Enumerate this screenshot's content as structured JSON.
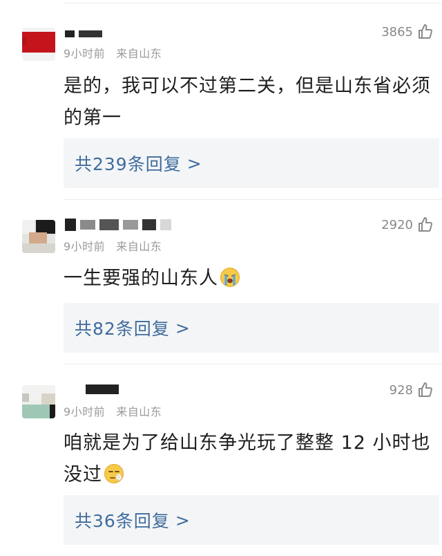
{
  "comments": [
    {
      "time": "9小时前",
      "location": "来自山东",
      "likes": "3865",
      "text": "是的，我可以不过第二关，但是山东省必须的第一",
      "reply_count": "共239条回复",
      "avatar_icon": "blurred-avatar",
      "like_icon": "thumbs-up-icon"
    },
    {
      "time": "9小时前",
      "location": "来自山东",
      "likes": "2920",
      "text": "一生要强的山东人",
      "emoji": "crying-face-emoji",
      "reply_count": "共82条回复",
      "avatar_icon": "blurred-avatar",
      "like_icon": "thumbs-up-icon"
    },
    {
      "time": "9小时前",
      "location": "来自山东",
      "likes": "928",
      "text": "咱就是为了给山东争光玩了整整 12 小时也没过",
      "emoji": "smirk-face-emoji",
      "reply_count": "共36条回复",
      "avatar_icon": "blurred-avatar",
      "like_icon": "thumbs-up-icon"
    }
  ],
  "reply_chevron": ">",
  "colors": {
    "link": "#3f6c9d",
    "meta": "#9a9a9a",
    "reply_bg": "#f4f5f7"
  }
}
